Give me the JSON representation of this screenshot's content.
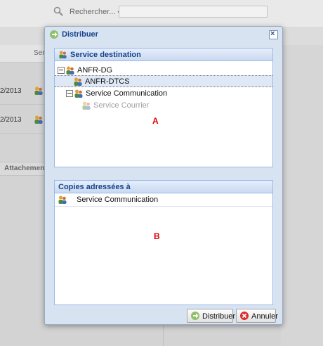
{
  "background": {
    "search_label": "Rechercher...",
    "search_caret": "▾",
    "column_header": "Ser",
    "rows": [
      {
        "date": "2/2013"
      },
      {
        "date": "2/2013"
      }
    ],
    "attachment_label": "Attachemen"
  },
  "dialog": {
    "title": "Distribuer",
    "close_glyph": "×",
    "destination_panel": {
      "title": "Service destination",
      "tree": [
        {
          "label": "ANFR-DG",
          "expanded": true,
          "level": 0,
          "selected": false,
          "disabled": false
        },
        {
          "label": "ANFR-DTCS",
          "level": 1,
          "selected": true,
          "disabled": false
        },
        {
          "label": "Service Communication",
          "expanded": true,
          "level": 1,
          "selected": false,
          "disabled": false
        },
        {
          "label": "Service Courrier",
          "level": 2,
          "selected": false,
          "disabled": true
        }
      ],
      "marker": "A"
    },
    "copies_panel": {
      "title": "Copies adressées à",
      "items": [
        {
          "label": "Service Communication"
        }
      ],
      "marker": "B"
    },
    "buttons": {
      "distribute_label": "Distribuer",
      "cancel_label": "Annuler"
    }
  },
  "icons": {
    "title": "arrow-right-icon",
    "group": "group-users-icon",
    "distribute": "distribute-arrow-icon",
    "cancel": "cancel-circle-icon"
  },
  "colors": {
    "title_text": "#15428b",
    "panel_border": "#99bbe8",
    "dialog_bg": "#d8e3f1",
    "marker": "#e00000"
  }
}
